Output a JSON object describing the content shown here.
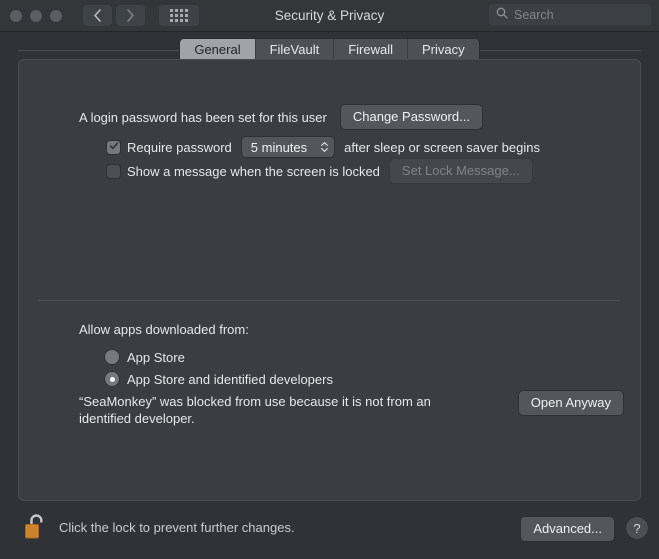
{
  "window": {
    "title": "Security & Privacy",
    "traffic_lights": [
      "close",
      "minimize",
      "zoom"
    ],
    "nav": {
      "back": "back-chevron",
      "forward": "forward-chevron",
      "grid": "all-preferences-grid"
    },
    "search": {
      "placeholder": "Search",
      "value": "",
      "icon": "search-icon"
    }
  },
  "tabs": [
    {
      "label": "General",
      "active": true
    },
    {
      "label": "FileVault",
      "active": false
    },
    {
      "label": "Firewall",
      "active": false
    },
    {
      "label": "Privacy",
      "active": false
    }
  ],
  "general": {
    "login_password_text": "A login password has been set for this user",
    "change_password_label": "Change Password...",
    "require_password": {
      "label": "Require password",
      "checked": true,
      "delay_value": "5 minutes",
      "suffix": "after sleep or screen saver begins"
    },
    "show_message": {
      "label": "Show a message when the screen is locked",
      "checked": false,
      "button_label": "Set Lock Message...",
      "button_disabled": true
    },
    "allow_apps_label": "Allow apps downloaded from:",
    "sources": [
      {
        "label": "App Store",
        "selected": false
      },
      {
        "label": "App Store and identified developers",
        "selected": true
      }
    ],
    "blocked_message": "“SeaMonkey” was blocked from use because it is not from an identified developer.",
    "open_anyway_label": "Open Anyway"
  },
  "bottom": {
    "lock_icon": "unlocked-padlock-icon",
    "lock_text": "Click the lock to prevent further changes.",
    "advanced_label": "Advanced...",
    "help_label": "?"
  },
  "colors": {
    "window_bg": "#2f3236",
    "panel_bg": "#3a3d41",
    "titlebar_bg": "#343639",
    "active_tab_bg": "#a0a3a7",
    "lock_body": "#d98b33",
    "text": "#e6e8ea"
  }
}
